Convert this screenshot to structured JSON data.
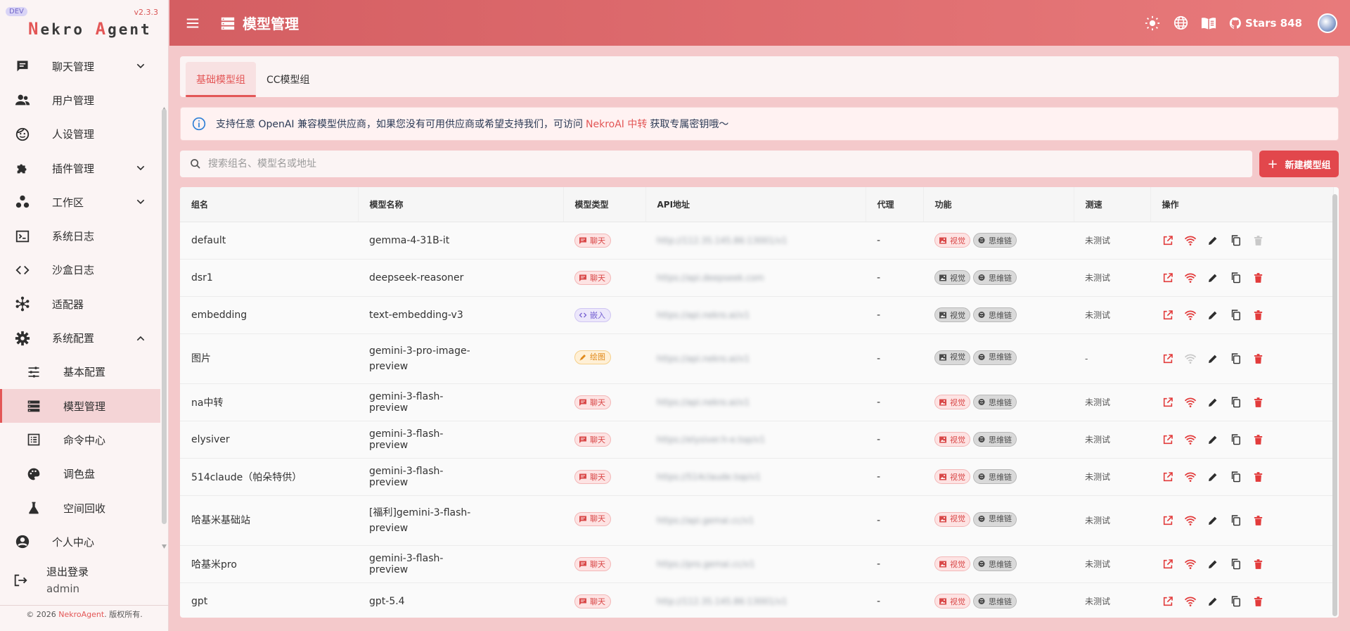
{
  "app": {
    "dev_badge": "DEV",
    "version": "v2.3.3",
    "brand_first_initial": "N",
    "brand_first_rest": "ekro ",
    "brand_second_initial": "A",
    "brand_second_rest": "gent"
  },
  "sidebar": {
    "items": [
      {
        "label": "聊天管理"
      },
      {
        "label": "用户管理"
      },
      {
        "label": "人设管理"
      },
      {
        "label": "插件管理"
      },
      {
        "label": "工作区"
      },
      {
        "label": "系统日志"
      },
      {
        "label": "沙盒日志"
      },
      {
        "label": "适配器"
      },
      {
        "label": "系统配置"
      },
      {
        "label": "基本配置"
      },
      {
        "label": "模型管理"
      },
      {
        "label": "命令中心"
      },
      {
        "label": "调色盘"
      },
      {
        "label": "空间回收"
      },
      {
        "label": "个人中心"
      }
    ],
    "logout_label": "退出登录",
    "username": "admin",
    "footer_prefix": "© 2026 ",
    "footer_link": "NekroAgent",
    "footer_suffix": ". 版权所有."
  },
  "header": {
    "title": "模型管理",
    "stars_label": "Stars 848"
  },
  "tabs": [
    {
      "label": "基础模型组"
    },
    {
      "label": "CC模型组"
    }
  ],
  "info": {
    "prefix": "支持任意 OpenAI 兼容模型供应商，如果您没有可用供应商或希望支持我们，可访问",
    "link": "NekroAI 中转",
    "suffix": "获取专属密钥哦～"
  },
  "search": {
    "placeholder": "搜索组名、模型名或地址"
  },
  "new_button_label": "新建模型组",
  "table": {
    "headers": [
      "组名",
      "模型名称",
      "模型类型",
      "API地址",
      "代理",
      "功能",
      "测速",
      "操作"
    ],
    "feature_vision": "视觉",
    "feature_cot": "思维链",
    "rows": [
      {
        "group": "default",
        "model": "gemma-4-31B-it",
        "type": "聊天",
        "api": "http://112.35.145.86:13001/v1",
        "proxy": "-",
        "speed": "未测试"
      },
      {
        "group": "dsr1",
        "model": "deepseek-reasoner",
        "type": "聊天",
        "api": "https://api.deepseek.com",
        "proxy": "-",
        "speed": "未测试"
      },
      {
        "group": "embedding",
        "model": "text-embedding-v3",
        "type": "嵌入",
        "api": "https://api.nekro.ai/v1",
        "proxy": "-",
        "speed": "未测试"
      },
      {
        "group": "图片",
        "model": "gemini-3-pro-image-preview",
        "type": "绘图",
        "api": "https://api.nekro.ai/v1",
        "proxy": "-",
        "speed": "-"
      },
      {
        "group": "na中转",
        "model": "gemini-3-flash-preview",
        "type": "聊天",
        "api": "https://api.nekro.ai/v1",
        "proxy": "-",
        "speed": "未测试"
      },
      {
        "group": "elysiver",
        "model": "gemini-3-flash-preview",
        "type": "聊天",
        "api": "https://elysiver.h-e.top/v1",
        "proxy": "-",
        "speed": "未测试"
      },
      {
        "group": "514claude（帕朵特供）",
        "model": "gemini-3-flash-preview",
        "type": "聊天",
        "api": "https://514claude.top/v1",
        "proxy": "-",
        "speed": "未测试"
      },
      {
        "group": "哈基米基础站",
        "model": "[福利]gemini-3-flash-preview",
        "type": "聊天",
        "api": "https://api.gemai.cc/v1",
        "proxy": "-",
        "speed": "未测试"
      },
      {
        "group": "哈基米pro",
        "model": "gemini-3-flash-preview",
        "type": "聊天",
        "api": "https://pro.gemai.cc/v1",
        "proxy": "-",
        "speed": "未测试"
      },
      {
        "group": "gpt",
        "model": "gpt-5.4",
        "type": "聊天",
        "api": "http://112.35.145.86:13001/v1",
        "proxy": "-",
        "speed": "未测试"
      }
    ]
  },
  "colors": {
    "accent": "#e35656",
    "header_start": "#d45e62",
    "header_end": "#e87a7b"
  }
}
